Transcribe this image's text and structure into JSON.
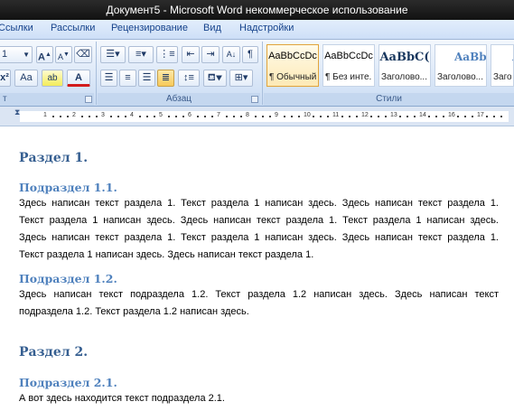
{
  "window": {
    "title": "Документ5 - Microsoft Word некоммерческое использование"
  },
  "tabs": [
    "Ссылки",
    "Рассылки",
    "Рецензирование",
    "Вид",
    "Надстройки"
  ],
  "ribbon": {
    "font_size_value": "1",
    "grow_font": "A",
    "shrink_font": "A",
    "change_case": "Aa",
    "font_color_letter": "A",
    "highlight_letter": "ab",
    "group_font_partial": "т",
    "group_paragraph": "Абзац",
    "group_styles": "Стили",
    "styles": [
      {
        "sample": "AaBbCcDc",
        "name": "¶ Обычный"
      },
      {
        "sample": "AaBbCcDc",
        "name": "¶ Без инте..."
      },
      {
        "sample": "AaBbC(",
        "name": "Заголово..."
      },
      {
        "sample": "AaBbCc",
        "name": "Заголово..."
      },
      {
        "sample": "AaB",
        "name": "Загол"
      }
    ],
    "pilcrow": "¶",
    "sort": "A↓"
  },
  "ruler": {
    "numbers": [
      "1",
      "2",
      "3",
      "4",
      "5",
      "6",
      "7",
      "8",
      "9",
      "10",
      "11",
      "12",
      "13",
      "14",
      "16",
      "17"
    ]
  },
  "document": {
    "s1_heading": "Раздел 1.",
    "s11_heading": "Подраздел 1.1.",
    "s11_lines": [
      "Здесь написан текст раздела 1. Текст раздела 1 написан здесь. Здесь написан текст раздела 1.",
      "Текст раздела 1 написан здесь. Здесь написан текст раздела 1. Текст раздела 1 написан здесь.",
      "Здесь написан текст раздела 1. Текст раздела 1 написан здесь. Здесь написан текст раздела 1.",
      "Текст раздела 1 написан здесь. Здесь написан текст раздела 1."
    ],
    "s12_heading": "Подраздел 1.2.",
    "s12_lines": [
      "Здесь написан текст подраздела 1.2. Текст раздела 1.2 написан здесь. Здесь написан текст",
      "подраздела 1.2. Текст раздела 1.2 написан здесь."
    ],
    "s2_heading": "Раздел 2.",
    "s21_heading": "Подраздел 2.1.",
    "s21_text": "А вот здесь находится текст подраздела 2.1."
  }
}
